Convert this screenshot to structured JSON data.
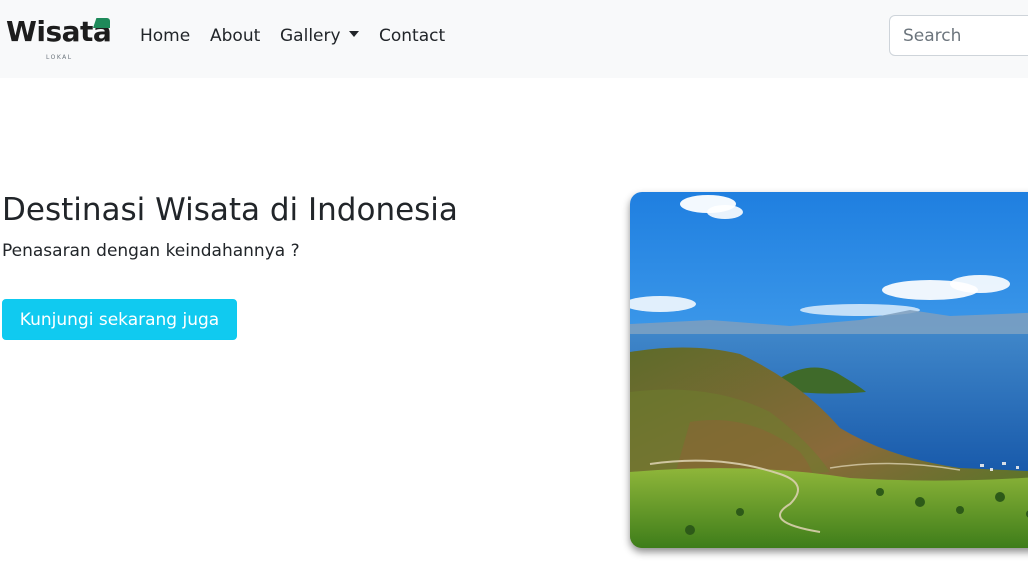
{
  "navbar": {
    "brand": {
      "name": "Wisata",
      "subtitle": "LOKAL"
    },
    "links": [
      {
        "label": "Home"
      },
      {
        "label": "About"
      },
      {
        "label": "Gallery"
      },
      {
        "label": "Contact"
      }
    ],
    "search": {
      "placeholder": "Search"
    }
  },
  "hero": {
    "title": "Destinasi Wisata di Indonesia",
    "subtitle": "Penasaran dengan keindahannya ?",
    "cta_label": "Kunjungi sekarang juga"
  },
  "colors": {
    "navbar_bg": "#f8f9fa",
    "cta_bg": "#10caf0",
    "brand_accent": "#1e8a5a"
  },
  "icons": {
    "gallery_dropdown": "caret-down-icon"
  }
}
